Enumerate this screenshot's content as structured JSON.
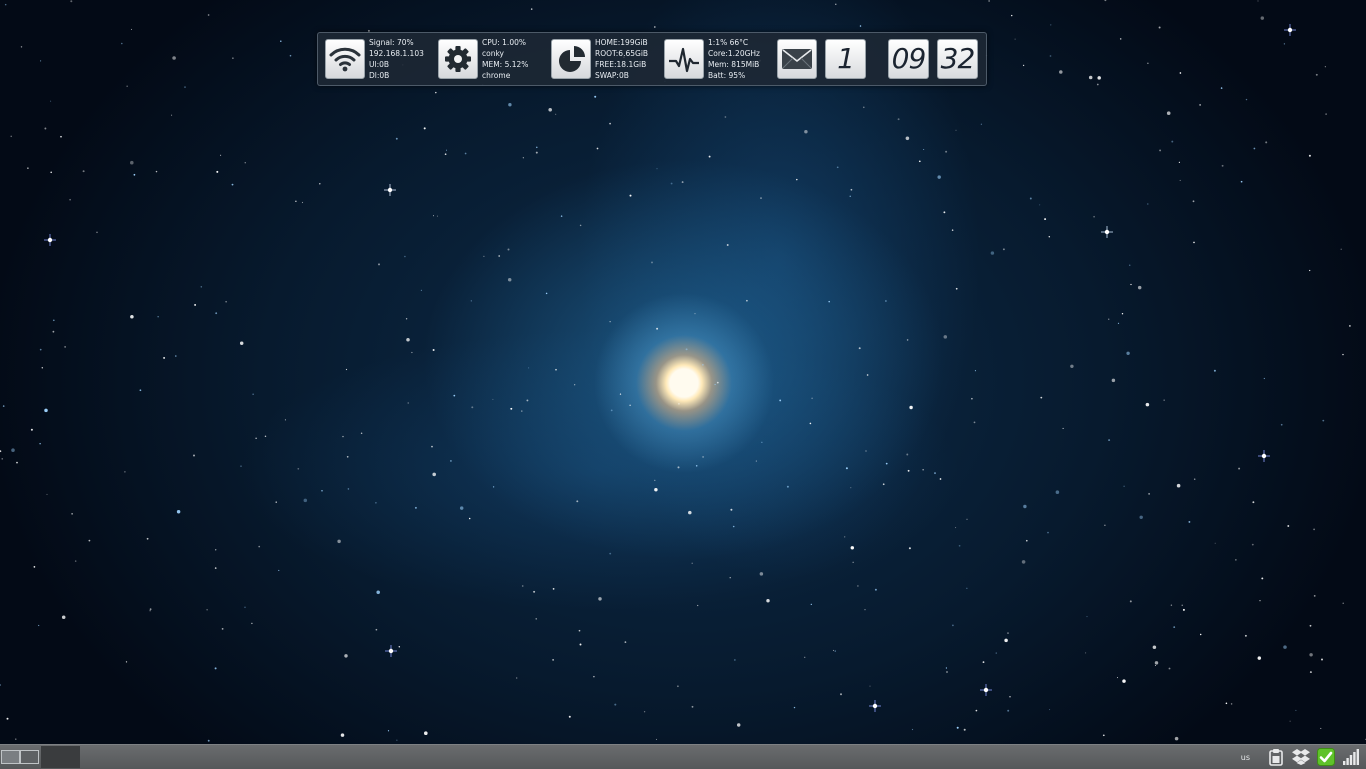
{
  "conky": {
    "network": {
      "icon": "wifi-icon",
      "signal": "Signal: 70%",
      "ip": "192.168.1.103",
      "upload": "Ul:0B",
      "download": "Dl:0B"
    },
    "process": {
      "icon": "gear-icon",
      "cpu": "CPU:  1.00%",
      "cpu_top": "conky",
      "mem": "MEM:  5.12%",
      "mem_top": "chrome"
    },
    "disk": {
      "icon": "disk-pie-icon",
      "home": "HOME:199GiB",
      "root": "ROOT:6.65GiB",
      "free": "FREE:18.1GiB",
      "swap": "SWAP:0B"
    },
    "system": {
      "icon": "pulse-icon",
      "load": "1:1%  66°C",
      "core": "Core:1.20GHz",
      "mem": "Mem: 815MiB",
      "batt": "Batt: 95%"
    },
    "mail": {
      "icon": "mail-icon",
      "count": "1"
    },
    "clock": {
      "hours": "09",
      "minutes": "32"
    }
  },
  "taskbar": {
    "keyboard_layout": "us",
    "tray_icons": [
      "clipboard-icon",
      "dropbox-icon",
      "update-check-icon",
      "signal-bars-icon"
    ]
  },
  "colors": {
    "accent_check": "#5fc22a",
    "taskbar": "#5f6163"
  }
}
